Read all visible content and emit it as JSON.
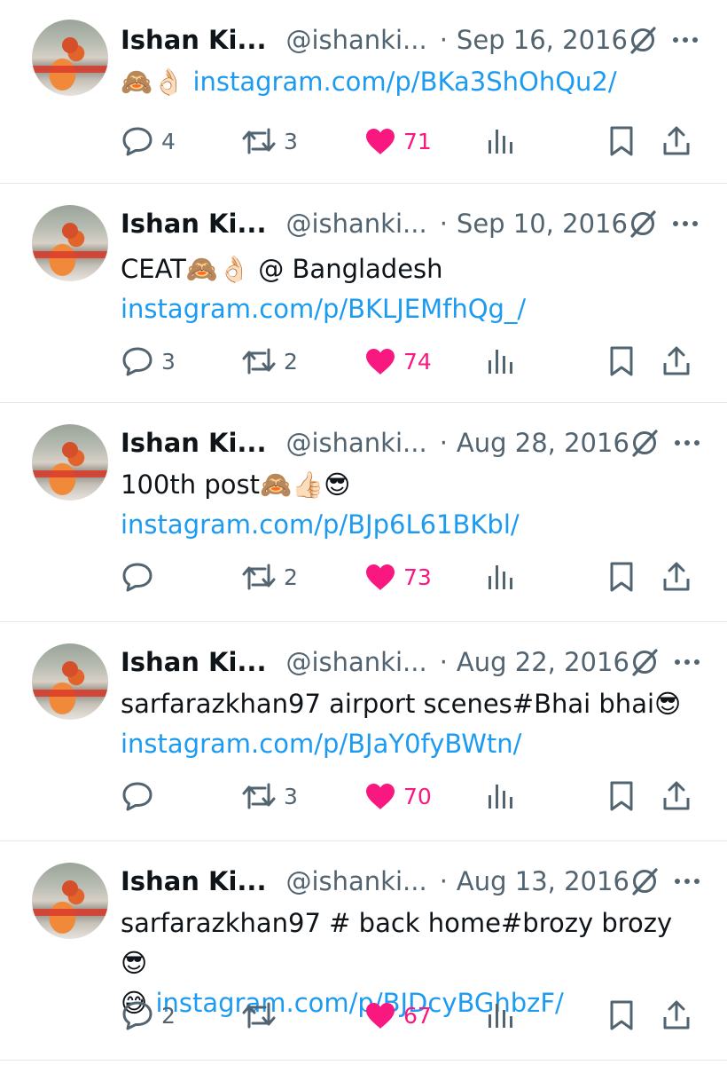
{
  "colors": {
    "link": "#1d9bf0",
    "like": "#f91880",
    "muted": "#536471",
    "text": "#0f1419"
  },
  "icons": {
    "reply": "comment-bubble-icon",
    "retweet": "retweet-icon",
    "like": "heart-filled-icon",
    "views": "views-bars-icon",
    "bookmark": "bookmark-icon",
    "share": "share-upload-icon",
    "grok": "grok-icon",
    "more": "more-dots-icon"
  },
  "tweets": [
    {
      "name": "Ishan Ki...",
      "handle": "@ishanki...",
      "separator": "·",
      "date": "Sep 16, 2016",
      "text": "🙈👌🏻",
      "link": "instagram.com/p/BKa3ShOhQu2/",
      "replies": "4",
      "retweets": "3",
      "likes": "71"
    },
    {
      "name": "Ishan Ki...",
      "handle": "@ishanki...",
      "separator": "·",
      "date": "Sep 10, 2016",
      "text": "CEAT🙈👌🏻 @ Bangladesh",
      "link": "instagram.com/p/BKLJEMfhQg_/",
      "replies": "3",
      "retweets": "2",
      "likes": "74"
    },
    {
      "name": "Ishan Ki...",
      "handle": "@ishanki...",
      "separator": "·",
      "date": "Aug 28, 2016",
      "text": "100th post🙈👍🏻😎",
      "link": "instagram.com/p/BJp6L61BKbl/",
      "replies": "",
      "retweets": "2",
      "likes": "73"
    },
    {
      "name": "Ishan Ki...",
      "handle": "@ishanki...",
      "separator": "·",
      "date": "Aug 22, 2016",
      "text": "sarfarazkhan97 airport scenes#Bhai bhai😎",
      "link": "instagram.com/p/BJaY0fyBWtn/",
      "replies": "",
      "retweets": "3",
      "likes": "70"
    },
    {
      "name": "Ishan Ki...",
      "handle": "@ishanki...",
      "separator": "·",
      "date": "Aug 13, 2016",
      "text": "sarfarazkhan97 # back home#brozy brozy😎",
      "text2": "😅",
      "link": "instagram.com/p/BJDcyBGhbzF/",
      "replies": "2",
      "retweets": "",
      "likes": "67"
    }
  ]
}
